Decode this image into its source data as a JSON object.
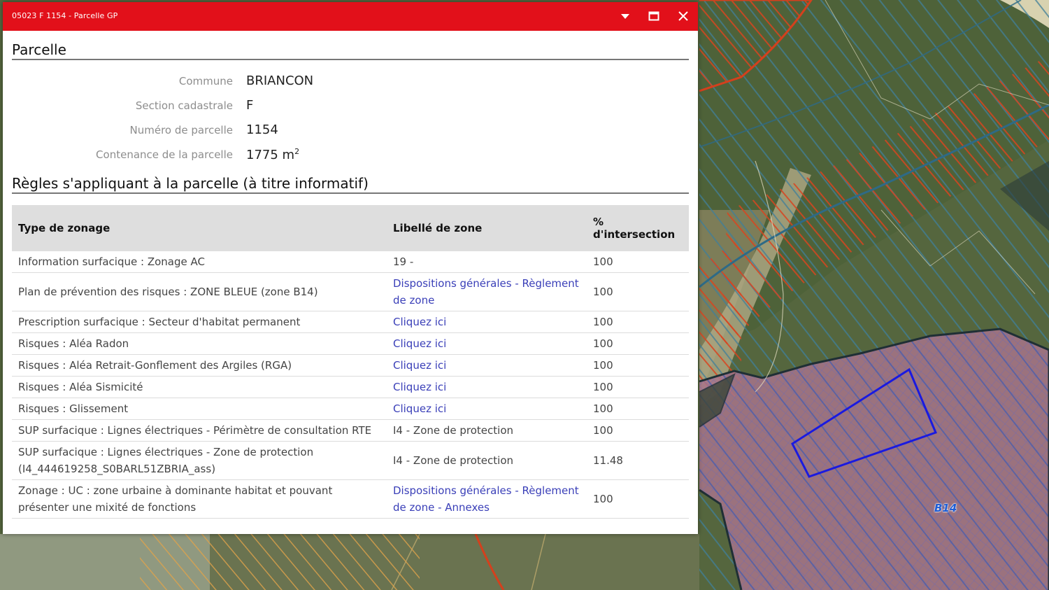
{
  "window": {
    "title": "05023 F 1154 - Parcelle GP",
    "buttons": [
      "collapse-arrow-icon",
      "maximize-icon",
      "close-icon"
    ]
  },
  "parcelle": {
    "heading": "Parcelle",
    "fields": [
      {
        "label": "Commune",
        "value": "BRIANCON"
      },
      {
        "label": "Section cadastrale",
        "value": "F"
      },
      {
        "label": "Numéro de parcelle",
        "value": "1154"
      },
      {
        "label": "Contenance de la parcelle",
        "value": "1775 m",
        "unit_sup": "2"
      }
    ]
  },
  "rules": {
    "heading": "Règles s'appliquant à la parcelle (à titre informatif)",
    "columns": [
      "Type de zonage",
      "Libellé de zone",
      "% d'intersection"
    ],
    "rows": [
      {
        "type": "Information surfacique : Zonage AC",
        "libelle": "19 -",
        "link": false,
        "pct": "100"
      },
      {
        "type": "Plan de prévention des risques : ZONE BLEUE (zone B14)",
        "libelle": "Dispositions générales - Règlement de zone",
        "link": true,
        "pct": "100"
      },
      {
        "type": "Prescription surfacique : Secteur d'habitat permanent",
        "libelle": "Cliquez ici",
        "link": true,
        "pct": "100"
      },
      {
        "type": "Risques : Aléa Radon",
        "libelle": "Cliquez ici",
        "link": true,
        "pct": "100"
      },
      {
        "type": "Risques : Aléa Retrait-Gonflement des Argiles (RGA)",
        "libelle": "Cliquez ici",
        "link": true,
        "pct": "100"
      },
      {
        "type": "Risques : Aléa Sismicité",
        "libelle": "Cliquez ici",
        "link": true,
        "pct": "100"
      },
      {
        "type": "Risques : Glissement",
        "libelle": "Cliquez ici",
        "link": true,
        "pct": "100"
      },
      {
        "type": "SUP surfacique : Lignes électriques - Périmètre de consultation RTE",
        "libelle": "I4 - Zone de protection",
        "link": false,
        "pct": "100"
      },
      {
        "type": "SUP surfacique : Lignes électriques - Zone de protection (I4_444619258_S0BARL51ZBRIA_ass)",
        "libelle": "I4 - Zone de protection",
        "link": false,
        "pct": "11.48"
      },
      {
        "type": "Zonage : UC : zone urbaine à dominante habitat et pouvant présenter une mixité de fonctions",
        "libelle": "Dispositions générales - Règlement de zone - Annexes",
        "link": true,
        "pct": "100"
      }
    ]
  },
  "map": {
    "zone_label": "B14"
  },
  "colors": {
    "titlebar": "#e2101a",
    "link": "#3a3fb8",
    "parcel_outline": "#1a1ae0"
  }
}
